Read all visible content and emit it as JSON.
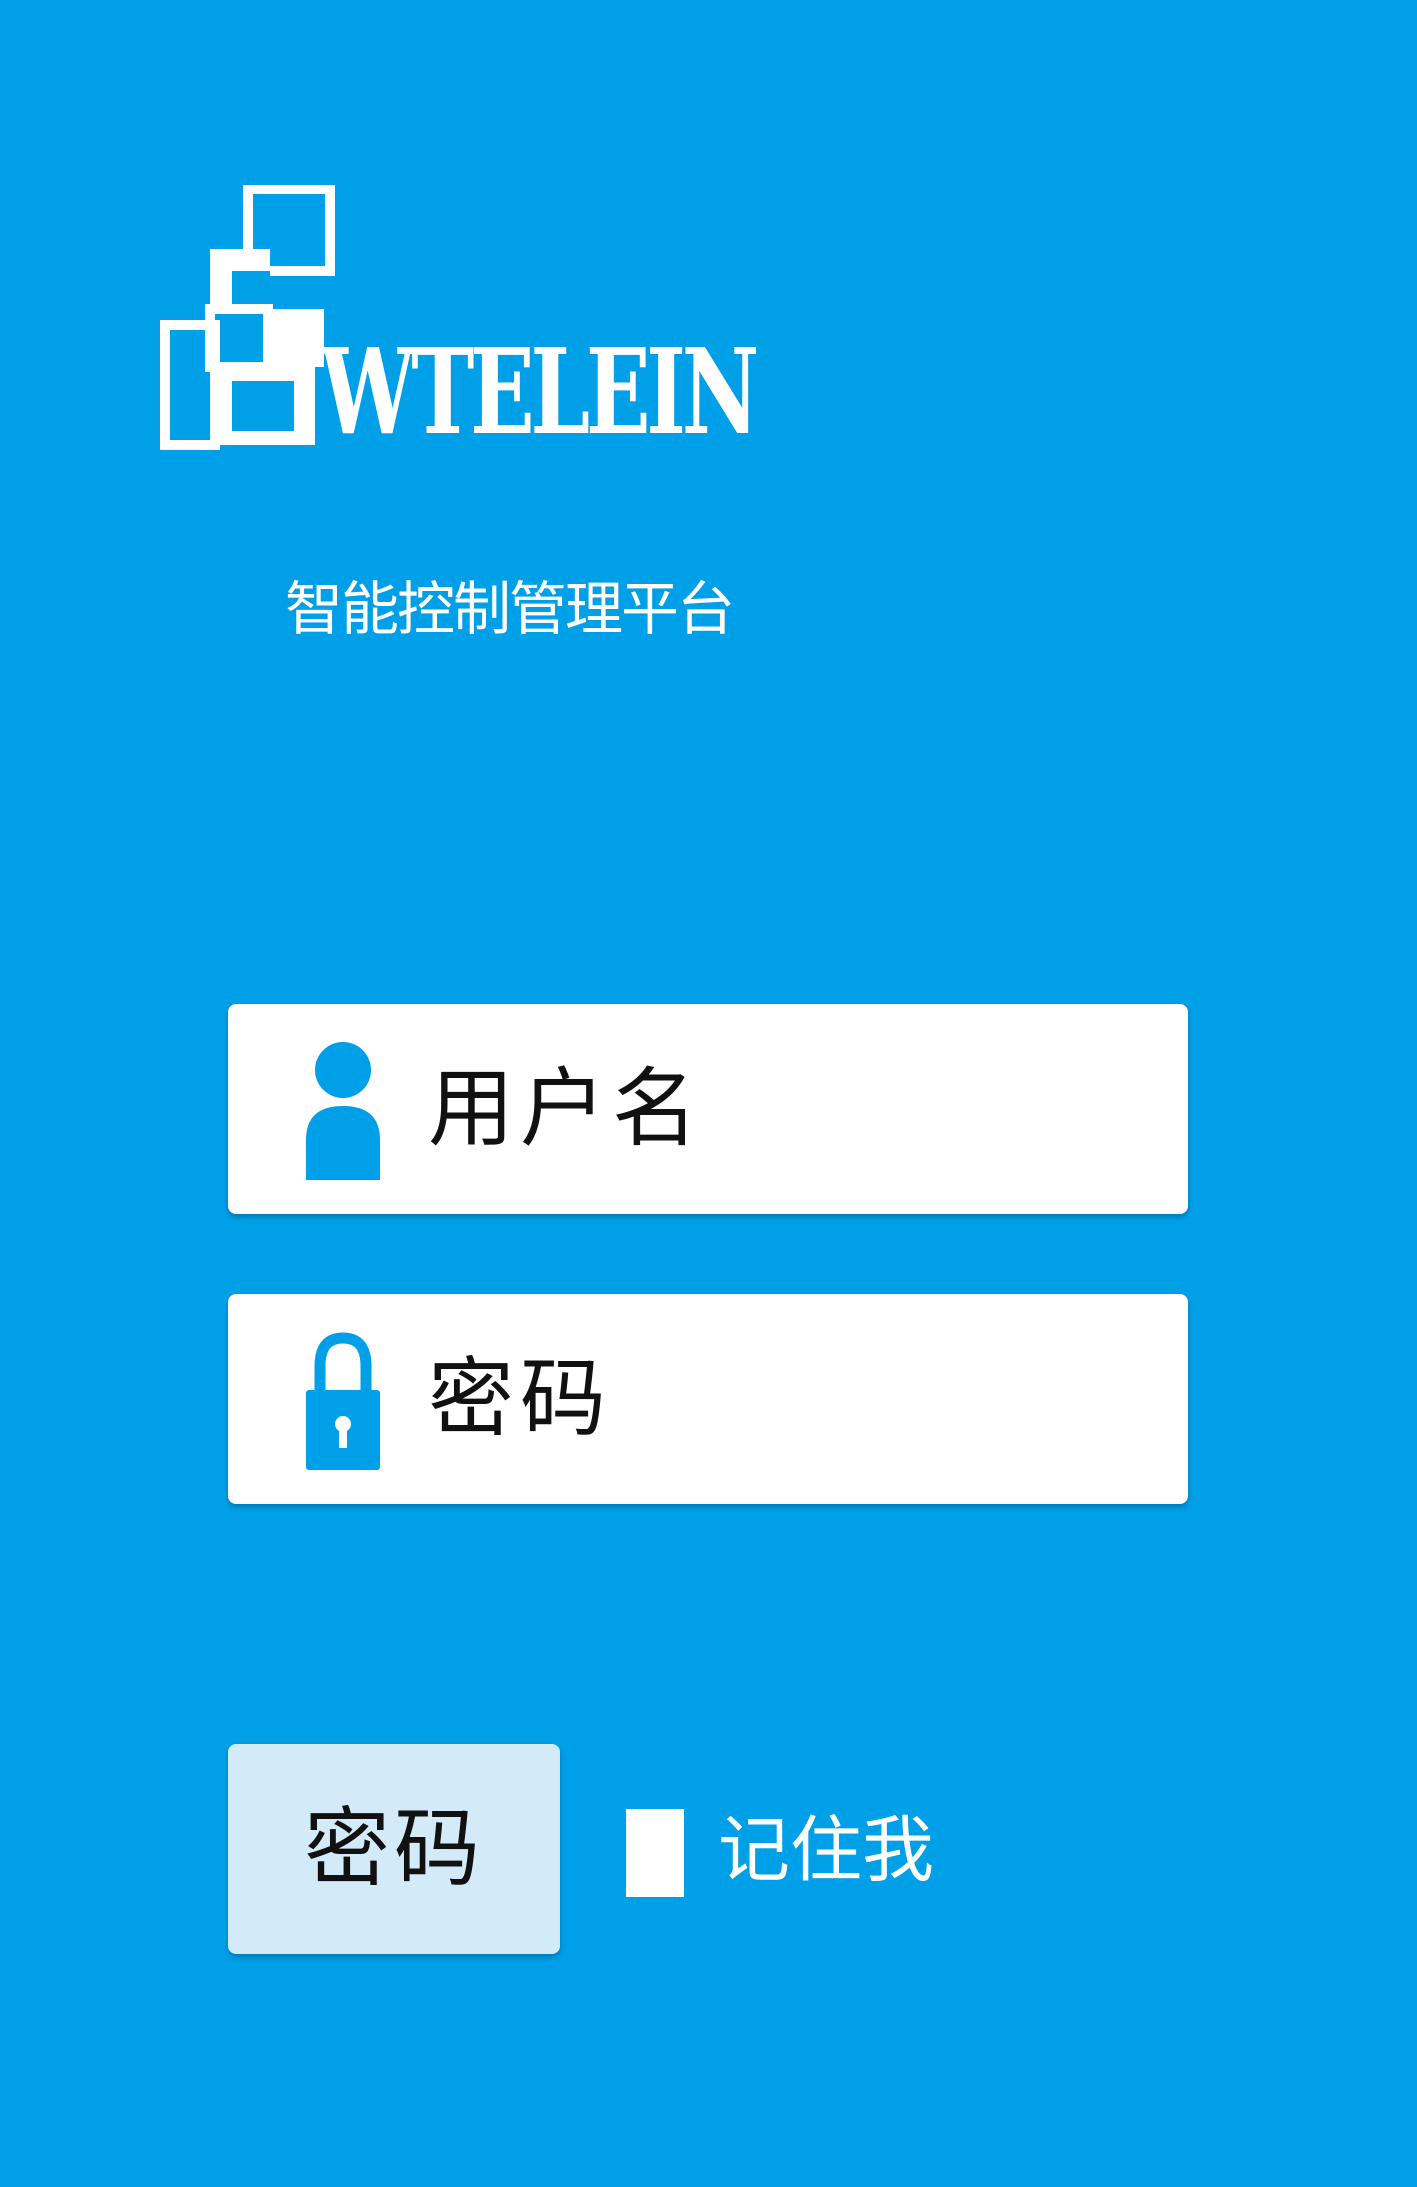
{
  "brand": {
    "logo_icon": "checker-squares-logo",
    "name": "WTELEIN",
    "subtitle": "智能控制管理平台"
  },
  "form": {
    "username": {
      "icon": "user-icon",
      "placeholder": "用户名"
    },
    "password": {
      "icon": "lock-icon",
      "placeholder": "密码"
    },
    "login_button_label": "密码",
    "remember_me": {
      "label": "记住我",
      "checked": false
    }
  },
  "colors": {
    "background": "#00a0e9",
    "icon": "#00a0e9",
    "button": "#d3ebf8",
    "field": "#ffffff"
  }
}
